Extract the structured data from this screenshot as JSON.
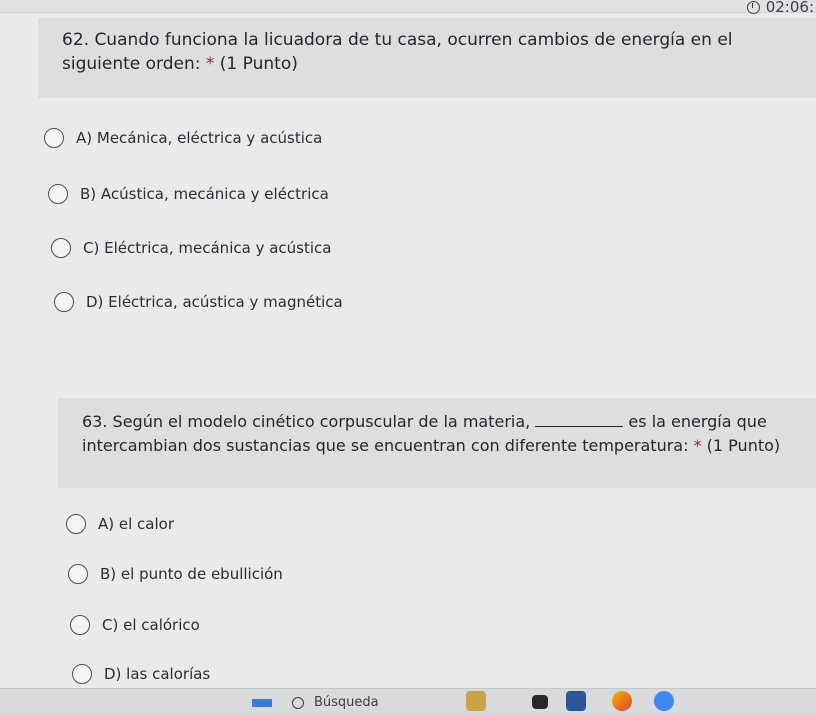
{
  "timer": {
    "text": "02:06:"
  },
  "questions": [
    {
      "text_part1": "62. Cuando funciona la licuadora de tu casa, ocurren cambios de energía en el siguiente orden:",
      "required_mark": "*",
      "points": "(1 Punto)",
      "options": [
        "A) Mecánica, eléctrica y acústica",
        "B) Acústica, mecánica y eléctrica",
        "C) Eléctrica, mecánica y acústica",
        "D) Eléctrica, acústica y magnética"
      ]
    },
    {
      "text_part1": "63. Según el modelo cinético corpuscular de la materia,",
      "text_part2": "es la energía que intercambian dos sustancias que se encuentran con diferente temperatura:",
      "required_mark": "*",
      "points": "(1 Punto)",
      "options": [
        "A) el calor",
        "B) el punto de ebullición",
        "C) el calórico",
        "D) las calorías"
      ]
    }
  ],
  "taskbar": {
    "search_label": "Búsqueda"
  },
  "colors": {
    "required": "#a4262c",
    "word_icon": "#2b579a",
    "chrome_icon": "#4285f4"
  }
}
